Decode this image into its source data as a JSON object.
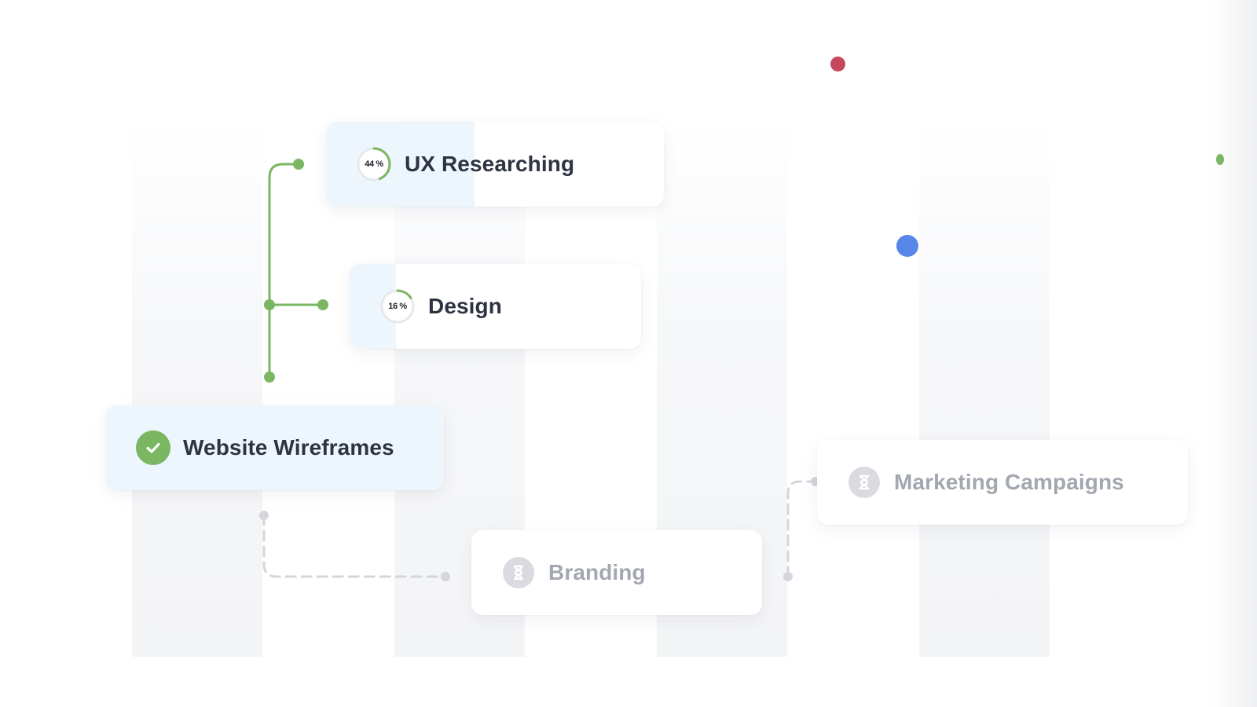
{
  "tasks": {
    "ux_research": {
      "label": "UX Researching",
      "progress_label": "44 %",
      "progress": 0.44
    },
    "design": {
      "label": "Design",
      "progress_label": "16 %",
      "progress": 0.16
    },
    "website_wireframes": {
      "label": "Website Wireframes",
      "status": "complete"
    },
    "branding": {
      "label": "Branding",
      "status": "pending"
    },
    "marketing_campaigns": {
      "label": "Marketing Campaigns",
      "status": "pending"
    }
  },
  "icons": {
    "complete": "check-icon",
    "pending": "hourglass-icon",
    "in_progress": "progress-ring-icon"
  },
  "colors": {
    "accent_green": "#7bb662",
    "muted_gray": "#d4d6db",
    "progress_fill": "#eef6fd",
    "dot_red": "#c6465a",
    "dot_blue": "#5686e8",
    "text_dark": "#2d3340",
    "text_muted": "#a3a7b0"
  }
}
